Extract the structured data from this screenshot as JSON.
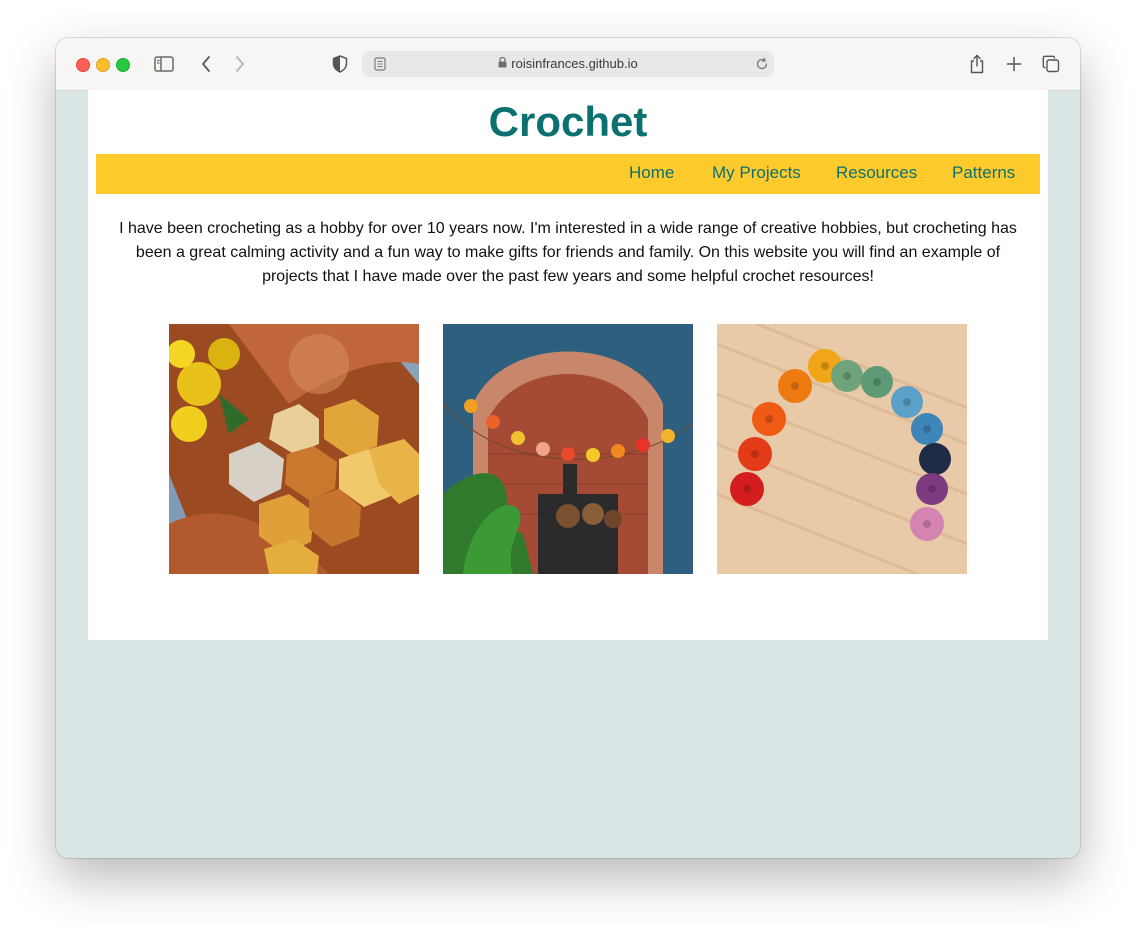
{
  "browser": {
    "url": "roisinfrances.github.io"
  },
  "site": {
    "title": "Crochet",
    "nav": [
      {
        "label": "Home"
      },
      {
        "label": "My Projects"
      },
      {
        "label": "Resources"
      },
      {
        "label": "Patterns"
      }
    ],
    "intro": "I have been crocheting as a hobby for over 10 years now. I'm interested in a wide range of creative hobbies, but crocheting has been a great calming activity and a fun way to make gifts for friends and family. On this website you will find an example of projects that I have made over the past few years and some helpful crochet resources!",
    "photos": [
      {
        "subject": "crochet-hexagon-coasters"
      },
      {
        "subject": "crochet-flower-garland-fireplace"
      },
      {
        "subject": "crochet-rainbow-flowers"
      }
    ]
  },
  "colors": {
    "accent_teal": "#0a7170",
    "nav_yellow": "#ffca2c",
    "page_background": "#dae5e5"
  }
}
